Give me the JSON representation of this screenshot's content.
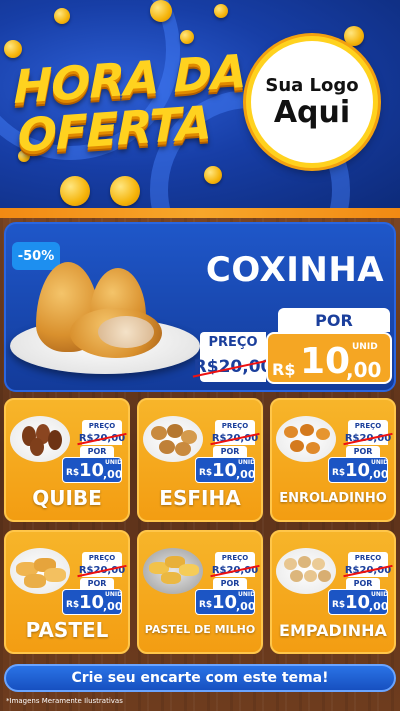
{
  "header": {
    "title_line1": "HORA DA",
    "title_line2": "OFERTA",
    "logo_line1": "Sua Logo",
    "logo_line2": "Aqui"
  },
  "featured": {
    "discount": "-50%",
    "name": "COXINHA",
    "preco_label": "PREÇO",
    "old_price": "R$20,00",
    "por_label": "POR",
    "currency": "R$",
    "price_int": "10",
    "price_dec": ",00",
    "unit": "UNID"
  },
  "products": [
    {
      "name": "QUIBE",
      "preco_label": "PREÇO",
      "old_price": "R$20,00",
      "por_label": "POR",
      "currency": "R$",
      "price_int": "10",
      "price_dec": ",00",
      "unit": "UNID"
    },
    {
      "name": "ESFIHA",
      "preco_label": "PREÇO",
      "old_price": "R$20,00",
      "por_label": "POR",
      "currency": "R$",
      "price_int": "10",
      "price_dec": ",00",
      "unit": "UNID"
    },
    {
      "name": "ENROLADINHO",
      "preco_label": "PREÇO",
      "old_price": "R$20,00",
      "por_label": "POR",
      "currency": "R$",
      "price_int": "10",
      "price_dec": ",00",
      "unit": "UNID"
    },
    {
      "name": "PASTEL",
      "preco_label": "PREÇO",
      "old_price": "R$20,00",
      "por_label": "POR",
      "currency": "R$",
      "price_int": "10",
      "price_dec": ",00",
      "unit": "UNID"
    },
    {
      "name": "PASTEL DE MILHO",
      "preco_label": "PREÇO",
      "old_price": "R$20,00",
      "por_label": "POR",
      "currency": "R$",
      "price_int": "10",
      "price_dec": ",00",
      "unit": "UNID"
    },
    {
      "name": "EMPADINHA",
      "preco_label": "PREÇO",
      "old_price": "R$20,00",
      "por_label": "POR",
      "currency": "R$",
      "price_int": "10",
      "price_dec": ",00",
      "unit": "UNID"
    }
  ],
  "cta": "Crie seu encarte com este tema!",
  "disclaimer": "*Imagens Meramente Ilustrativas",
  "colors": {
    "header_blue": "#173ea6",
    "accent_yellow": "#ffd21f",
    "card_orange": "#f5a623",
    "price_blue": "#1c55c4",
    "wood": "#6b3d1f"
  }
}
